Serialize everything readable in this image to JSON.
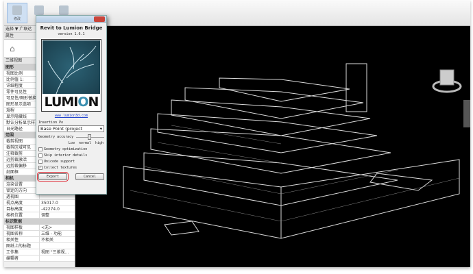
{
  "ribbon": {
    "buttons": [
      "修改",
      "",
      "",
      ""
    ]
  },
  "properties": {
    "header": "选择 ▼ 广联达",
    "panel_title": "属性",
    "type_label": "三维视图",
    "sections": [
      {
        "title": "图形",
        "rows": [
          [
            "视图比例",
            ""
          ],
          [
            "比例值 1:",
            ""
          ],
          [
            "详细程度",
            ""
          ],
          [
            "零件可见性",
            ""
          ],
          [
            "可见性/图形替换",
            ""
          ],
          [
            "图形显示选项",
            ""
          ],
          [
            "规程",
            ""
          ],
          [
            "显示隐藏线",
            ""
          ],
          [
            "默认分析显示样式",
            ""
          ],
          [
            "日光路径",
            ""
          ]
        ]
      },
      {
        "title": "范围",
        "rows": [
          [
            "裁剪视图",
            ""
          ],
          [
            "裁剪区域可见",
            ""
          ],
          [
            "注释裁剪",
            ""
          ],
          [
            "远剪裁激活",
            ""
          ],
          [
            "远剪裁偏移",
            ""
          ],
          [
            "剖面框",
            ""
          ]
        ]
      },
      {
        "title": "相机",
        "rows": [
          [
            "渲染设置",
            ""
          ],
          [
            "锁定的方向",
            ""
          ],
          [
            "透视图",
            ""
          ],
          [
            "视点高度",
            "35017.0"
          ],
          [
            "目标高度",
            "-42274.0"
          ],
          [
            "相机位置",
            "调整"
          ]
        ]
      },
      {
        "title": "标识数据",
        "rows": [
          [
            "视图样板",
            "<无>"
          ],
          [
            "视图名称",
            "三维 - 功能"
          ],
          [
            "相关性",
            "不相关"
          ],
          [
            "图纸上的标题",
            ""
          ],
          [
            "工作集",
            "视图 \"三维视..."
          ],
          [
            "编辑者",
            ""
          ]
        ]
      }
    ]
  },
  "dialog": {
    "title": "Revit to Lumion Bridge",
    "version": "version 1.6.1",
    "logo_text": "LUMION",
    "link": "www.lumion3d.com",
    "insertion_label": "Insertion Po",
    "insertion_value": "Base Point (project",
    "accuracy_label": "Geometry accuracy",
    "ticks": [
      "Low",
      "normal",
      "high"
    ],
    "options": [
      {
        "label": "Geometry optimization",
        "checked": false
      },
      {
        "label": "Skip interior details",
        "checked": false
      },
      {
        "label": "Unicode support",
        "checked": false
      },
      {
        "label": "Collect textures",
        "checked": true
      }
    ],
    "export": "Export",
    "cancel": "Cancel"
  }
}
